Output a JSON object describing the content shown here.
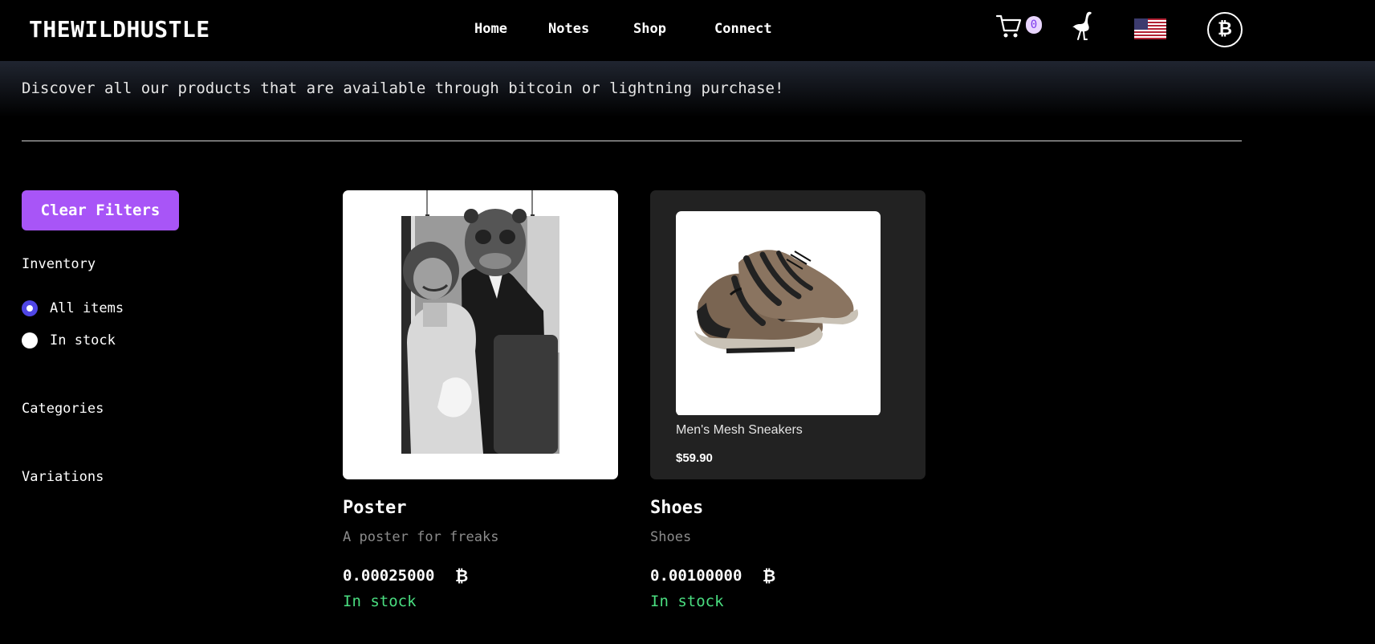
{
  "header": {
    "logo": "THEWILDHUSTLE",
    "nav": [
      "Home",
      "Notes",
      "Shop",
      "Connect"
    ],
    "cart_count": "0",
    "btc_glyph": "₿"
  },
  "page": {
    "tagline": "Discover all our products that are available through bitcoin or lightning purchase!"
  },
  "filters": {
    "clear_label": "Clear Filters",
    "inventory_title": "Inventory",
    "options": [
      {
        "label": "All items",
        "checked": true
      },
      {
        "label": "In stock",
        "checked": false
      }
    ],
    "categories_title": "Categories",
    "variations_title": "Variations"
  },
  "products": [
    {
      "name": "Poster",
      "description": "A poster for freaks",
      "price": "0.00025000",
      "currency_glyph": "₿",
      "stock": "In stock",
      "image": "poster-image"
    },
    {
      "name": "Shoes",
      "description": "Shoes",
      "price": "0.00100000",
      "currency_glyph": "₿",
      "stock": "In stock",
      "image": "sneakers-image",
      "image_caption": "Men's Mesh Sneakers",
      "image_price": "$59.90"
    }
  ],
  "colors": {
    "accent": "#a855f7",
    "radio_checked": "#4f46e5",
    "in_stock": "#4ade80",
    "background": "#000000"
  }
}
